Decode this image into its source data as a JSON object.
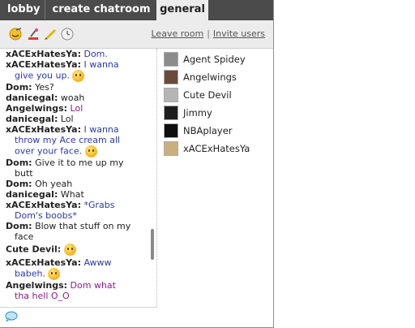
{
  "tabs": [
    {
      "label": "lobby",
      "active": false
    },
    {
      "label": "create chatroom",
      "active": false
    },
    {
      "label": "general",
      "active": true
    }
  ],
  "toolbar": {
    "icons": [
      "emoticon-icon",
      "eyedropper-icon",
      "pencil-icon",
      "clock-icon"
    ],
    "leave_room": "Leave room",
    "separator": "|",
    "invite_users": "Invite users"
  },
  "messages": [
    {
      "name": "xACExHatesYa:",
      "text": "Dom.",
      "color": "#2a3aa8",
      "smiley": false
    },
    {
      "name": "xACExHatesYa:",
      "text": "I wanna",
      "cont": "give you up.",
      "color": "#2a3aa8",
      "smiley": true
    },
    {
      "name": "Dom:",
      "text": "Yes?",
      "color": "#222222",
      "smiley": false
    },
    {
      "name": "danicegal:",
      "text": "woah",
      "color": "#222222",
      "smiley": false
    },
    {
      "name": "Angelwings:",
      "text": "Lol",
      "color": "#8b1c8b",
      "smiley": false
    },
    {
      "name": "danicegal:",
      "text": "Lol",
      "color": "#222222",
      "smiley": false
    },
    {
      "name": "xACExHatesYa:",
      "text": "I wanna",
      "cont": "throw my Ace cream all",
      "cont2": "over your face.",
      "color": "#2a3aa8",
      "smiley": true
    },
    {
      "name": "Dom:",
      "text": "Give it to me up my",
      "cont": "butt",
      "color": "#222222",
      "smiley": false
    },
    {
      "name": "Dom:",
      "text": "Oh yeah",
      "color": "#222222",
      "smiley": false
    },
    {
      "name": "danicegal:",
      "text": "What",
      "color": "#222222",
      "smiley": false
    },
    {
      "name": "xACExHatesYa:",
      "text": "*Grabs",
      "cont": "Dom's boobs*",
      "color": "#2a3aa8",
      "smiley": false
    },
    {
      "name": "Dom:",
      "text": "Blow that stuff on my",
      "cont": "face",
      "color": "#222222",
      "smiley": false
    },
    {
      "name": "Cute Devil:",
      "text": "",
      "color": "#222222",
      "smiley": true
    },
    {
      "name": "xACExHatesYa:",
      "text": "Awww",
      "cont": "babeh.",
      "color": "#2a3aa8",
      "smiley": true
    },
    {
      "name": "Angelwings:",
      "text": "Dom what",
      "cont": "tha hell O_O",
      "color": "#8b1c8b",
      "smiley": false
    }
  ],
  "users": [
    {
      "name": "Agent Spidey",
      "avatar_color": "#8c8c8c"
    },
    {
      "name": "Angelwings",
      "avatar_color": "#6a4a3a"
    },
    {
      "name": "Cute Devil",
      "avatar_color": "#b5b5b5"
    },
    {
      "name": "Jimmy",
      "avatar_color": "#1e1e1e"
    },
    {
      "name": "NBAplayer",
      "avatar_color": "#0e0e0e"
    },
    {
      "name": "xACExHatesYa",
      "avatar_color": "#c9b07a"
    }
  ]
}
